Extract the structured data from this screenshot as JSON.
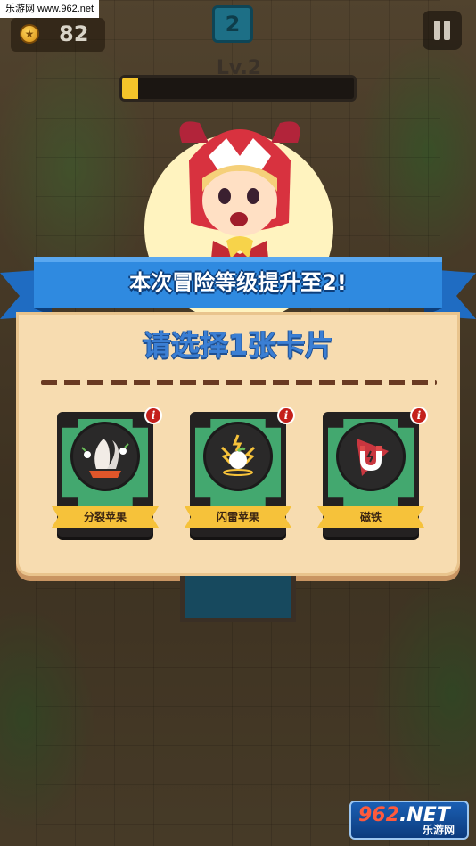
{
  "watermark": {
    "top_text": "乐游网 www.962.net",
    "logo_main_a": "962",
    "logo_main_b": ".NET",
    "logo_sub": "乐游网"
  },
  "hud": {
    "coins": "82",
    "stage": "2",
    "level_label": "Lv.2",
    "xp_progress": 0.07,
    "pause_icon": "pause-icon",
    "coin_icon": "coin-icon"
  },
  "banner": {
    "title": "本次冒险等级提升至2!"
  },
  "dialog": {
    "title": "请选择1张卡片",
    "cards": [
      {
        "label": "分裂苹果",
        "icon": "split-apple-icon"
      },
      {
        "label": "闪雷苹果",
        "icon": "thunder-apple-icon"
      },
      {
        "label": "磁铁",
        "icon": "magnet-icon"
      }
    ],
    "info_glyph": "i"
  },
  "colors": {
    "ribbon": "#2f8ae0",
    "panel": "#f7dcb0",
    "card_face": "#43a86f",
    "label": "#f6c23a",
    "title_blue": "#3b7fd4"
  }
}
